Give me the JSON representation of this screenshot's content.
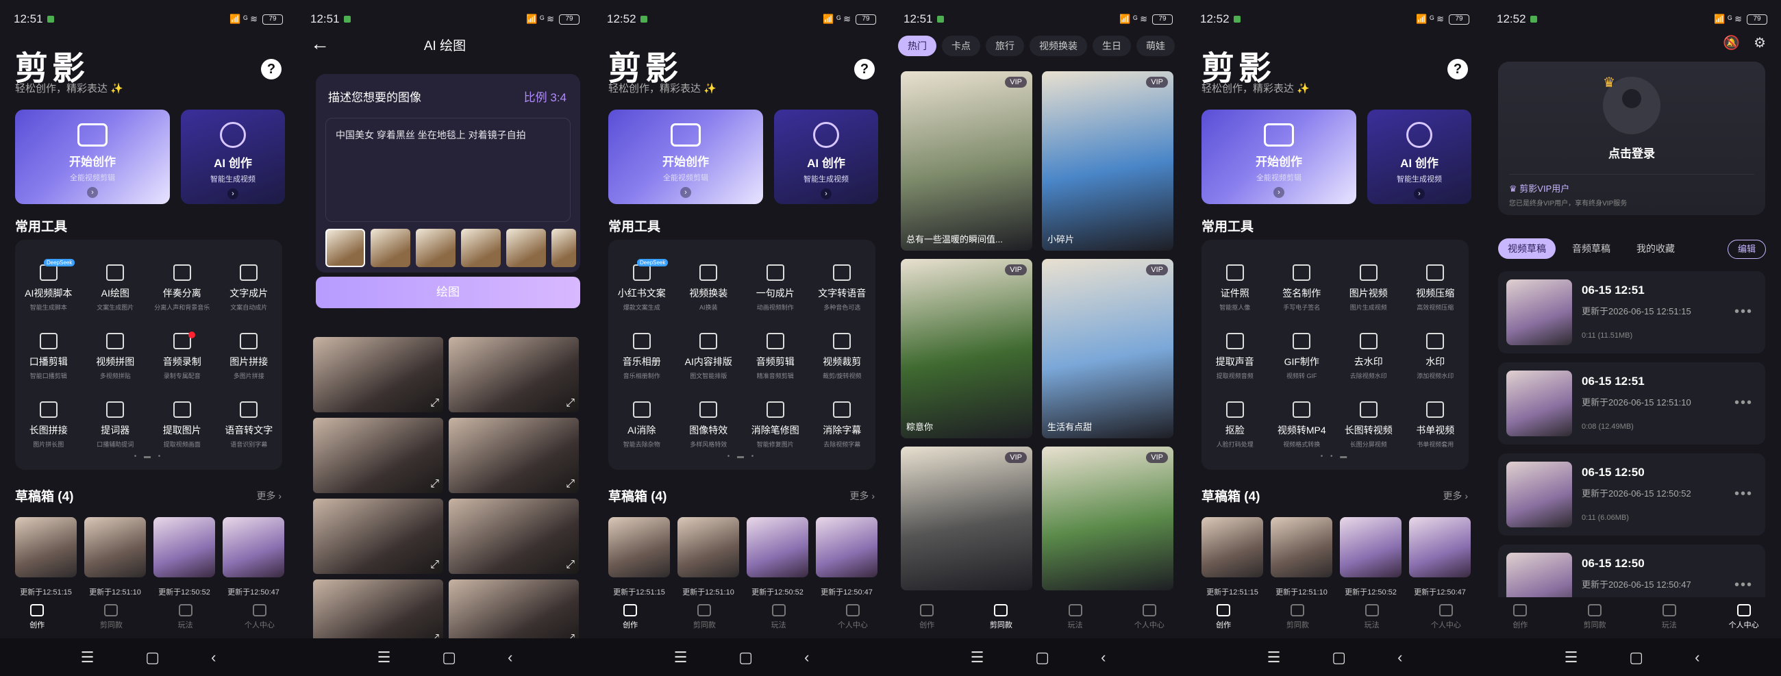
{
  "status": {
    "time1": "12:51",
    "time2": "12:51",
    "time3": "12:52",
    "time4": "12:51",
    "time5": "12:52",
    "time6": "12:52",
    "signal": "⁵⁶ᴳ📶📶",
    "battery": "79"
  },
  "home": {
    "logo": "剪影",
    "slogan": "轻松创作，精彩表达 ✨",
    "help": "?",
    "start_title": "开始创作",
    "start_sub": "全能视频剪辑",
    "ai_title": "AI 创作",
    "ai_sub": "智能生成视频",
    "tools_title": "常用工具",
    "tools_page1": [
      {
        "name": "AI视频脚本",
        "desc": "智能生成脚本",
        "badge": "DeepSeek"
      },
      {
        "name": "AI绘图",
        "desc": "文案生成图片"
      },
      {
        "name": "伴奏分离",
        "desc": "分离人声和背景音乐"
      },
      {
        "name": "文字成片",
        "desc": "文案自动成片"
      },
      {
        "name": "口播剪辑",
        "desc": "智能口播剪辑"
      },
      {
        "name": "视频拼图",
        "desc": "多视频拼贴"
      },
      {
        "name": "音频录制",
        "desc": "录制专属配音",
        "dot": true
      },
      {
        "name": "图片拼接",
        "desc": "多图片拼接"
      },
      {
        "name": "长图拼接",
        "desc": "图片拼长图"
      },
      {
        "name": "提词器",
        "desc": "口播辅助提词"
      },
      {
        "name": "提取图片",
        "desc": "提取视频画面"
      },
      {
        "name": "语音转文字",
        "desc": "语音识别字幕"
      }
    ],
    "tools_page2": [
      {
        "name": "小红书文案",
        "desc": "爆款文案生成",
        "badge": "DeepSeek"
      },
      {
        "name": "视频换装",
        "desc": "AI换装"
      },
      {
        "name": "一句成片",
        "desc": "动画视频制作"
      },
      {
        "name": "文字转语音",
        "desc": "多种音色可选"
      },
      {
        "name": "音乐相册",
        "desc": "音乐相册制作"
      },
      {
        "name": "AI内容排版",
        "desc": "图文智能排版"
      },
      {
        "name": "音频剪辑",
        "desc": "精准音频剪辑"
      },
      {
        "name": "视频裁剪",
        "desc": "裁剪/旋转视频"
      },
      {
        "name": "AI消除",
        "desc": "智能去除杂物"
      },
      {
        "name": "图像特效",
        "desc": "多样风格特效"
      },
      {
        "name": "消除笔修图",
        "desc": "智能修复图片"
      },
      {
        "name": "消除字幕",
        "desc": "去除视频字幕"
      }
    ],
    "tools_page3": [
      {
        "name": "证件照",
        "desc": "智能抠人像"
      },
      {
        "name": "签名制作",
        "desc": "手写电子签名"
      },
      {
        "name": "图片视频",
        "desc": "图片生成视频"
      },
      {
        "name": "视频压缩",
        "desc": "高效视频压缩"
      },
      {
        "name": "提取声音",
        "desc": "提取视频音频"
      },
      {
        "name": "GIF制作",
        "desc": "视频转 GIF"
      },
      {
        "name": "去水印",
        "desc": "去除视频水印"
      },
      {
        "name": "水印",
        "desc": "添加视频水印"
      },
      {
        "name": "抠脸",
        "desc": "人脸打码处理"
      },
      {
        "name": "视频转MP4",
        "desc": "视频格式转换"
      },
      {
        "name": "长图转视频",
        "desc": "长图分屏视频"
      },
      {
        "name": "书单视频",
        "desc": "书单视频套用"
      }
    ],
    "drafts_title": "草稿箱 (4)",
    "more": "更多 ›",
    "drafts": [
      "更新于12:51:15",
      "更新于12:51:10",
      "更新于12:50:52",
      "更新于12:50:47"
    ]
  },
  "tabs": [
    "创作",
    "剪同款",
    "玩法",
    "个人中心"
  ],
  "nav": [
    "☰",
    "▢",
    "‹"
  ],
  "aidraw": {
    "title": "AI 绘图",
    "back": "←",
    "label": "描述您想要的图像",
    "ratio": "比例 3:4",
    "prompt": "中国美女 穿着黑丝 坐在地毯上 对着镜子自拍",
    "button": "绘图"
  },
  "templates": {
    "chips": [
      "热门",
      "卡点",
      "旅行",
      "视频换装",
      "生日",
      "萌娃"
    ],
    "items": [
      {
        "caption": "总有一些温暖的瞬间值...",
        "vip": "VIP",
        "color": "#7d8a6a"
      },
      {
        "caption": "小碎片",
        "vip": "VIP",
        "color": "#4a86c8"
      },
      {
        "caption": "粽意你",
        "vip": "VIP",
        "color": "#3f6a30"
      },
      {
        "caption": "生活有点甜",
        "vip": "VIP",
        "color": "#7aa7d8"
      },
      {
        "caption": "",
        "vip": "VIP",
        "color": "#555"
      },
      {
        "caption": "",
        "vip": "VIP",
        "color": "#5a8a4a"
      }
    ]
  },
  "profile": {
    "login": "点击登录",
    "vip_title": "剪影VIP用户",
    "vip_desc": "您已是终身VIP用户，享有终身VIP服务",
    "tabs": [
      "视频草稿",
      "音频草稿",
      "我的收藏"
    ],
    "edit": "编辑",
    "drafts": [
      {
        "name": "06-15 12:51",
        "updated": "更新于2026-06-15 12:51:15",
        "size": "0:11 (11.51MB)"
      },
      {
        "name": "06-15 12:51",
        "updated": "更新于2026-06-15 12:51:10",
        "size": "0:08 (12.49MB)"
      },
      {
        "name": "06-15 12:50",
        "updated": "更新于2026-06-15 12:50:52",
        "size": "0:11 (6.06MB)"
      },
      {
        "name": "06-15 12:50",
        "updated": "更新于2026-06-15 12:50:47",
        "size": ""
      }
    ]
  }
}
